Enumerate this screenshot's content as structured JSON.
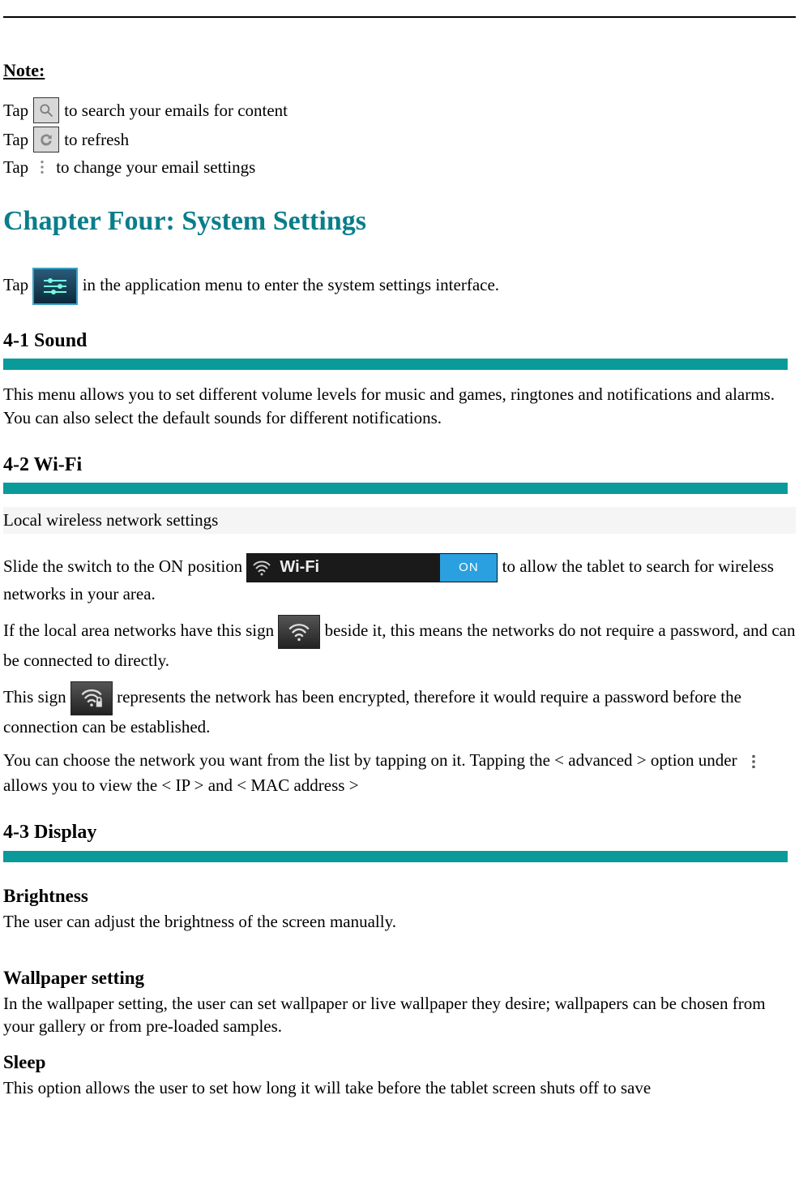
{
  "note": {
    "label": "Note:",
    "lines": [
      {
        "prefix": "Tap ",
        "icon": "search-icon",
        "suffix": " to search your emails for content"
      },
      {
        "prefix": "Tap ",
        "icon": "refresh-icon",
        "suffix": " to refresh"
      },
      {
        "prefix": "Tap ",
        "icon": "menu-dots-icon",
        "suffix": " to change your email settings"
      }
    ]
  },
  "chapter": {
    "title": "Chapter Four: System Settings",
    "intro_prefix": "Tap ",
    "intro_suffix": " in the application menu to enter the system settings interface."
  },
  "sections": {
    "sound": {
      "title": "4-1 Sound",
      "body": "This menu allows you to set different volume levels for music and games, ringtones and notifications and alarms.    You can also select the default sounds for different notifications."
    },
    "wifi": {
      "title": "4-2 Wi-Fi",
      "subtitle": "Local wireless network settings",
      "toggle": {
        "label": "Wi-Fi",
        "state": "ON"
      },
      "p1_pre": "Slide the switch to the ON position ",
      "p1_post": " to allow the tablet to search for wireless networks in your area.",
      "p2_pre": "If the local area networks have this sign ",
      "p2_post": " beside it, this means the networks do not require a password, and can be connected to directly.",
      "p3_pre": "This sign ",
      "p3_post": " represents the network has been encrypted, therefore it would require a password before the connection can be established.",
      "p4_pre": "You can choose the network you want from the list by tapping on it. Tapping the < advanced > option under ",
      "p4_post": " allows you to view the < IP > and < MAC address >"
    },
    "display": {
      "title": "4-3 Display",
      "brightness_h": "Brightness",
      "brightness_b": "The user can adjust the brightness of the screen manually.",
      "wallpaper_h": "Wallpaper setting",
      "wallpaper_b": "In the wallpaper setting, the user can set wallpaper or live wallpaper they desire; wallpapers can be chosen from your gallery or from pre-loaded samples.",
      "sleep_h": "Sleep",
      "sleep_b": "This option allows the user to set how long it will take before the tablet screen shuts off to save"
    }
  }
}
